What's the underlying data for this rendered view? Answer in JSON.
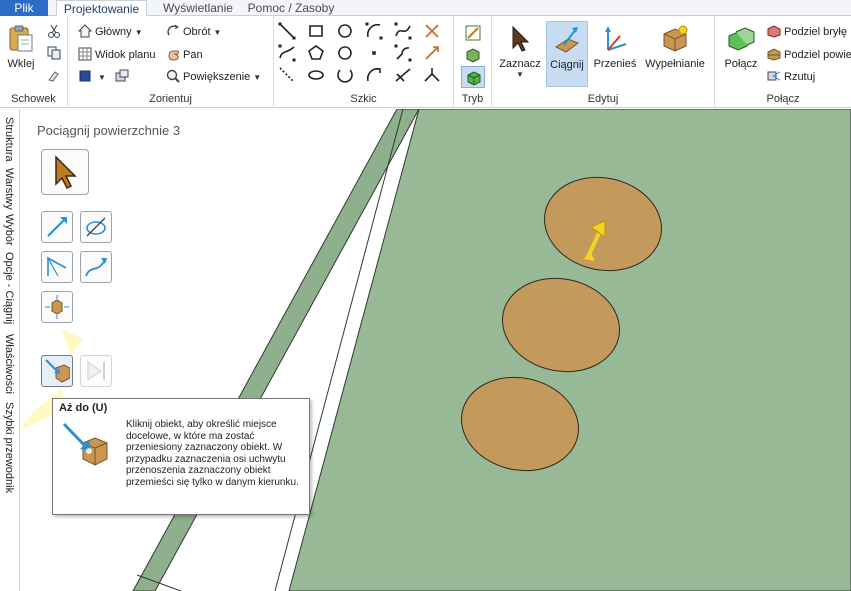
{
  "tabs": [
    {
      "label": "Plik"
    },
    {
      "label": "Projektowanie"
    },
    {
      "label": "Wyświetlanie"
    },
    {
      "label": "Pomoc / Zasoby"
    }
  ],
  "ribbon": {
    "clipboard": {
      "label": "Schowek",
      "paste": "Wklej"
    },
    "orient": {
      "label": "Zorientuj",
      "home": "Główny",
      "rotate": "Obrót",
      "plan_view": "Widok planu",
      "pan": "Pan",
      "zoom": "Powiększenie"
    },
    "sketch": {
      "label": "Szkic"
    },
    "mode": {
      "label": "Tryb"
    },
    "edit": {
      "label": "Edytuj",
      "select": "Zaznacz",
      "pull": "Ciągnij",
      "move": "Przenieś",
      "fill": "Wypełnianie"
    },
    "intersect": {
      "label": "Połącz",
      "combine": "Połącz",
      "split_body": "Podziel bryłę",
      "split_face": "Podziel powie",
      "project": "Rzutuj"
    }
  },
  "side_tabs": [
    "Struktura",
    "Warstwy",
    "Wybór",
    "Opcje - Ciągnij",
    "Właściwości",
    "Szybki przewodnik"
  ],
  "viewport": {
    "title": "Pociągnij powierzchnie 3"
  },
  "tooltip": {
    "title": "Aż do (U)",
    "body": "Kliknij obiekt, aby określić miejsce docelowe, w które ma zostać przeniesiony zaznaczony obiekt. W przypadku zaznaczenia osi uchwytu przenoszenia zaznaczony obiekt przemieści się tylko w danym kierunku."
  },
  "colors": {
    "accent": "#2b6cc4",
    "plate_top": "#98b996",
    "plate_side": "#8fb08d",
    "hole_fill": "#c49a5c",
    "pull_arrow": "#f5d31c"
  }
}
